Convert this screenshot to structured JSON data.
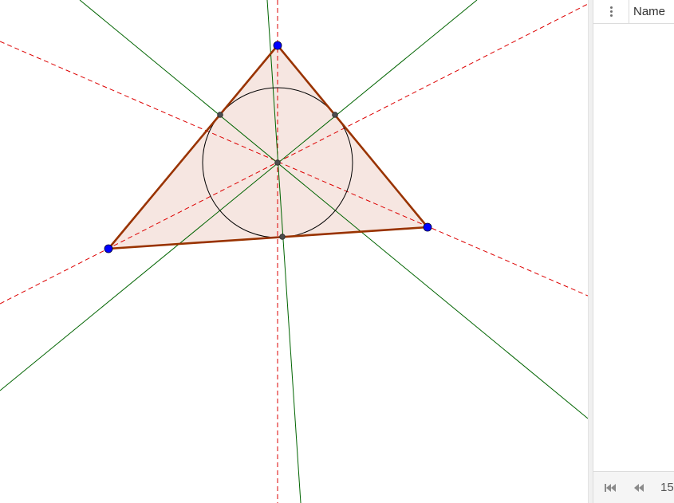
{
  "graphics_view": {
    "colors": {
      "triangle_edge": "#993300",
      "triangle_fill": "#f6e6e1",
      "vertex_point": "#0000ff",
      "helper_point": "#333333",
      "angle_bisector": "#006400",
      "perpendicular_bisector": "#dd0000",
      "incircle": "#000000"
    }
  },
  "construction_panel": {
    "menu_icon": "kebab-menu-icon",
    "name_column_header": "Name",
    "footer": {
      "first_step_icon": "skip-to-first-icon",
      "previous_step_icon": "rewind-icon",
      "step_counter": "15"
    }
  }
}
